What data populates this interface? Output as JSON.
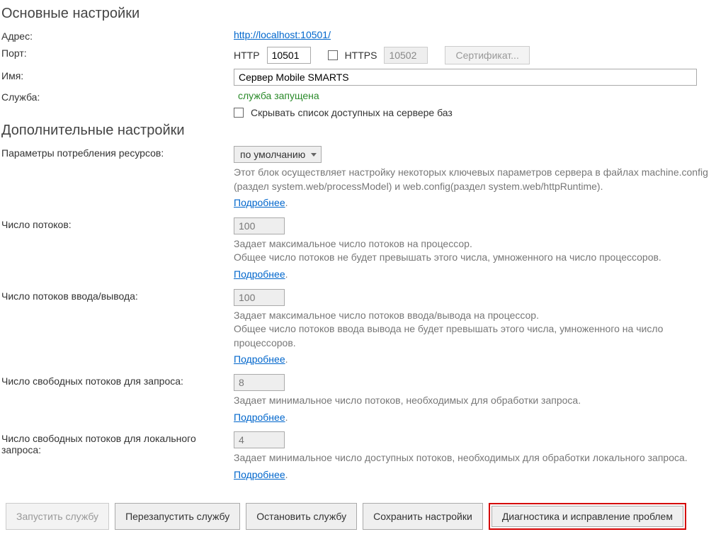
{
  "main": {
    "heading": "Основные настройки",
    "address_label": "Адрес:",
    "address_url": "http://localhost:10501/",
    "port_label": "Порт:",
    "http_label": "HTTP",
    "http_port": "10501",
    "https_label": "HTTPS",
    "https_port": "10502",
    "cert_button": "Сертификат...",
    "name_label": "Имя:",
    "name_value": "Сервер Mobile SMARTS",
    "service_label": "Служба:",
    "service_status": "служба запущена",
    "hide_bases_label": "Скрывать список доступных на сервере баз"
  },
  "extra": {
    "heading": "Дополнительные настройки",
    "resources_label": "Параметры потребления ресурсов:",
    "resources_select": "по умолчанию",
    "resources_desc": "Этот блок осуществляет настройку некоторых ключевых параметров сервера в файлах machine.config (раздел system.web/processModel) и web.config(раздел system.web/httpRuntime).",
    "more_link": "Подробнее",
    "threads_label": "Число потоков:",
    "threads_value": "100",
    "threads_desc": "Задает максимальное число потоков на процессор.\nОбщее число потоков не будет превышать этого числа, умноженного на число процессоров.",
    "io_threads_label": "Число потоков ввода/вывода:",
    "io_threads_value": "100",
    "io_threads_desc": "Задает максимальное число потоков ввода/вывода на процессор.\nОбщее число потоков ввода вывода не будет превышать этого числа, умноженного на число процессоров.",
    "free_req_label": "Число свободных потоков для запроса:",
    "free_req_value": "8",
    "free_req_desc": "Задает минимальное число потоков, необходимых для обработки запроса.",
    "free_local_label": "Число свободных потоков для локального запроса:",
    "free_local_value": "4",
    "free_local_desc": "Задает минимальное число доступных потоков, необходимых для обработки локального запроса."
  },
  "footer": {
    "start": "Запустить службу",
    "restart": "Перезапустить службу",
    "stop": "Остановить службу",
    "save": "Сохранить настройки",
    "diag": "Диагностика и исправление проблем"
  }
}
